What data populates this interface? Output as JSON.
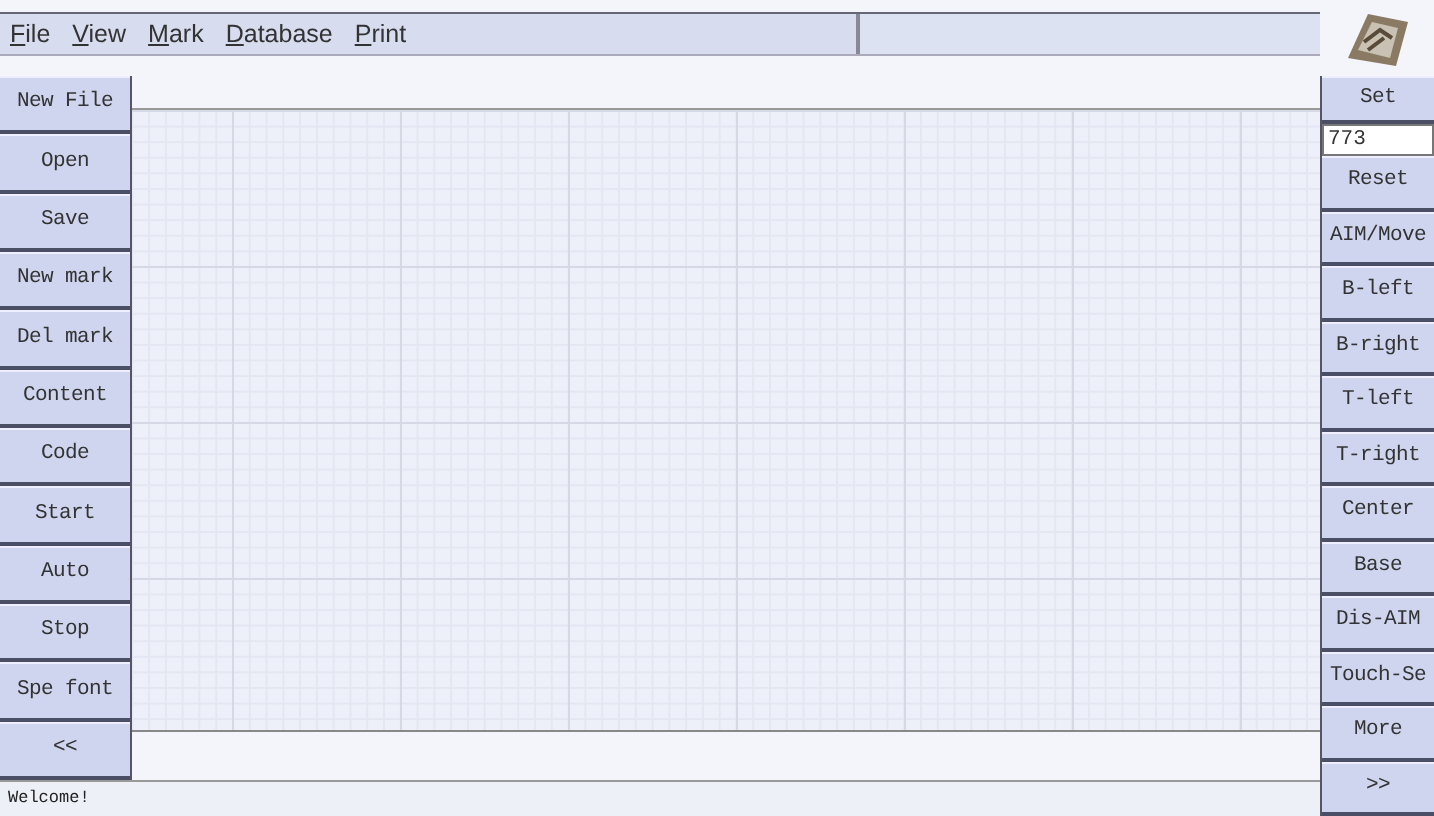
{
  "menu": [
    "File",
    "View",
    "Mark",
    "Database",
    "Print"
  ],
  "left_buttons": [
    "New File",
    "Open",
    "Save",
    "New mark",
    "Del mark",
    "Content",
    "Code",
    "Start",
    "Auto",
    "Stop",
    "Spe font",
    "<<"
  ],
  "right_panel": [
    {
      "kind": "button",
      "label": "Set"
    },
    {
      "kind": "field",
      "value": "773"
    },
    {
      "kind": "button",
      "label": "Reset"
    },
    {
      "kind": "button",
      "label": "AIM/Move"
    },
    {
      "kind": "button",
      "label": "B-left"
    },
    {
      "kind": "button",
      "label": "B-right"
    },
    {
      "kind": "button",
      "label": "T-left"
    },
    {
      "kind": "button",
      "label": "T-right"
    },
    {
      "kind": "button",
      "label": "Center"
    },
    {
      "kind": "button",
      "label": "Base"
    },
    {
      "kind": "button",
      "label": "Dis-AIM"
    },
    {
      "kind": "button",
      "label": "Touch-Se"
    },
    {
      "kind": "button",
      "label": "More"
    },
    {
      "kind": "button",
      "label": ">>"
    }
  ],
  "status_bar": "Welcome!"
}
